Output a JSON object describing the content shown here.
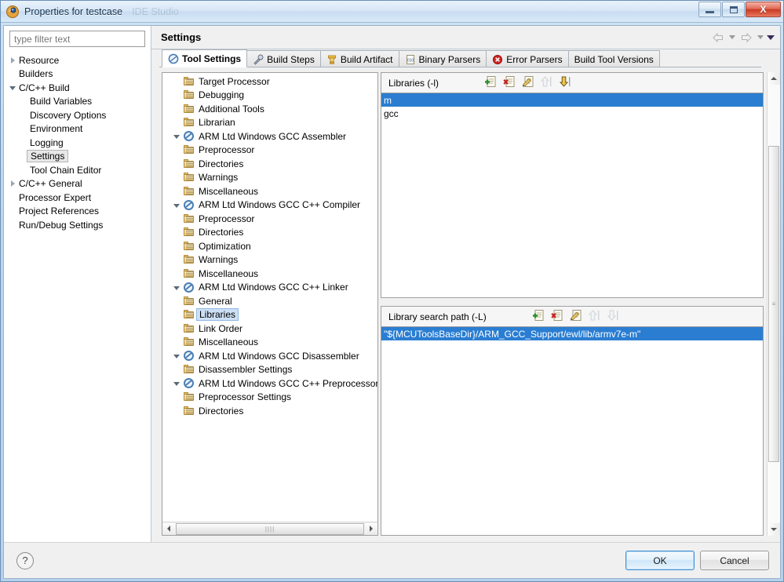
{
  "window": {
    "title": "Properties for testcase",
    "ghost_title": "IDE Studio",
    "app_icon": "eclipse-icon",
    "buttons": {
      "minimize": "minimize-icon",
      "maximize": "maximize-icon",
      "close": "X"
    }
  },
  "filter": {
    "placeholder": "type filter text",
    "value": ""
  },
  "nav_tree": [
    {
      "label": "Resource",
      "indent": 0,
      "twisty": "collapsed",
      "selected": false
    },
    {
      "label": "Builders",
      "indent": 0,
      "twisty": "none",
      "selected": false
    },
    {
      "label": "C/C++ Build",
      "indent": 0,
      "twisty": "expanded",
      "selected": false
    },
    {
      "label": "Build Variables",
      "indent": 1,
      "twisty": "none",
      "selected": false
    },
    {
      "label": "Discovery Options",
      "indent": 1,
      "twisty": "none",
      "selected": false
    },
    {
      "label": "Environment",
      "indent": 1,
      "twisty": "none",
      "selected": false
    },
    {
      "label": "Logging",
      "indent": 1,
      "twisty": "none",
      "selected": false
    },
    {
      "label": "Settings",
      "indent": 1,
      "twisty": "none",
      "selected": true
    },
    {
      "label": "Tool Chain Editor",
      "indent": 1,
      "twisty": "none",
      "selected": false
    },
    {
      "label": "C/C++ General",
      "indent": 0,
      "twisty": "collapsed",
      "selected": false
    },
    {
      "label": "Processor Expert",
      "indent": 0,
      "twisty": "none",
      "selected": false
    },
    {
      "label": "Project References",
      "indent": 0,
      "twisty": "none",
      "selected": false
    },
    {
      "label": "Run/Debug Settings",
      "indent": 0,
      "twisty": "none",
      "selected": false
    }
  ],
  "page": {
    "title": "Settings",
    "nav": {
      "back": "back-arrow-icon",
      "back_menu": "chevron-down-icon",
      "forward": "forward-arrow-icon",
      "forward_menu": "chevron-down-icon",
      "view_menu": "chevron-down-icon"
    }
  },
  "tabs": [
    {
      "label": "Tool Settings",
      "icon": "gear-icon",
      "active": true
    },
    {
      "label": "Build Steps",
      "icon": "wrench-icon",
      "active": false
    },
    {
      "label": "Build Artifact",
      "icon": "artifact-icon",
      "active": false
    },
    {
      "label": "Binary Parsers",
      "icon": "binary-doc-icon",
      "active": false
    },
    {
      "label": "Error Parsers",
      "icon": "error-icon",
      "active": false
    },
    {
      "label": "Build Tool Versions",
      "icon": "none",
      "active": false
    }
  ],
  "tool_tree": [
    {
      "label": "Target Processor",
      "level": 1,
      "twisty": "none",
      "icon": "folder-icon",
      "selected": false
    },
    {
      "label": "Debugging",
      "level": 1,
      "twisty": "none",
      "icon": "folder-icon",
      "selected": false
    },
    {
      "label": "Additional Tools",
      "level": 1,
      "twisty": "none",
      "icon": "folder-icon",
      "selected": false
    },
    {
      "label": "Librarian",
      "level": 1,
      "twisty": "none",
      "icon": "folder-icon",
      "selected": false
    },
    {
      "label": "ARM Ltd Windows GCC Assembler",
      "level": 0,
      "twisty": "expanded",
      "icon": "gear-icon",
      "selected": false
    },
    {
      "label": "Preprocessor",
      "level": 1,
      "twisty": "none",
      "icon": "folder-icon",
      "selected": false
    },
    {
      "label": "Directories",
      "level": 1,
      "twisty": "none",
      "icon": "folder-icon",
      "selected": false
    },
    {
      "label": "Warnings",
      "level": 1,
      "twisty": "none",
      "icon": "folder-icon",
      "selected": false
    },
    {
      "label": "Miscellaneous",
      "level": 1,
      "twisty": "none",
      "icon": "folder-icon",
      "selected": false
    },
    {
      "label": "ARM Ltd Windows GCC C++ Compiler",
      "level": 0,
      "twisty": "expanded",
      "icon": "gear-icon",
      "selected": false
    },
    {
      "label": "Preprocessor",
      "level": 1,
      "twisty": "none",
      "icon": "folder-icon",
      "selected": false
    },
    {
      "label": "Directories",
      "level": 1,
      "twisty": "none",
      "icon": "folder-icon",
      "selected": false
    },
    {
      "label": "Optimization",
      "level": 1,
      "twisty": "none",
      "icon": "folder-icon",
      "selected": false
    },
    {
      "label": "Warnings",
      "level": 1,
      "twisty": "none",
      "icon": "folder-icon",
      "selected": false
    },
    {
      "label": "Miscellaneous",
      "level": 1,
      "twisty": "none",
      "icon": "folder-icon",
      "selected": false
    },
    {
      "label": "ARM Ltd Windows GCC C++ Linker",
      "level": 0,
      "twisty": "expanded",
      "icon": "gear-icon",
      "selected": false
    },
    {
      "label": "General",
      "level": 1,
      "twisty": "none",
      "icon": "folder-icon",
      "selected": false
    },
    {
      "label": "Libraries",
      "level": 1,
      "twisty": "none",
      "icon": "folder-icon",
      "selected": true
    },
    {
      "label": "Link Order",
      "level": 1,
      "twisty": "none",
      "icon": "folder-icon",
      "selected": false
    },
    {
      "label": "Miscellaneous",
      "level": 1,
      "twisty": "none",
      "icon": "folder-icon",
      "selected": false
    },
    {
      "label": "ARM Ltd Windows GCC Disassembler",
      "level": 0,
      "twisty": "expanded",
      "icon": "gear-icon",
      "selected": false
    },
    {
      "label": "Disassembler Settings",
      "level": 1,
      "twisty": "none",
      "icon": "folder-icon",
      "selected": false
    },
    {
      "label": "ARM Ltd Windows GCC C++ Preprocessor",
      "level": 0,
      "twisty": "expanded",
      "icon": "gear-icon",
      "selected": false
    },
    {
      "label": "Preprocessor Settings",
      "level": 1,
      "twisty": "none",
      "icon": "folder-icon",
      "selected": false
    },
    {
      "label": "Directories",
      "level": 1,
      "twisty": "none",
      "icon": "folder-icon",
      "selected": false
    }
  ],
  "libraries_panel": {
    "title": "Libraries (-l)",
    "toolbar": [
      {
        "name": "add-icon",
        "enabled": true
      },
      {
        "name": "delete-icon",
        "enabled": true
      },
      {
        "name": "edit-icon",
        "enabled": true
      },
      {
        "name": "move-up-icon",
        "enabled": false
      },
      {
        "name": "move-down-icon",
        "enabled": true
      }
    ],
    "items": [
      {
        "value": "m",
        "selected": true
      },
      {
        "value": "gcc",
        "selected": false
      }
    ]
  },
  "search_path_panel": {
    "title": "Library search path (-L)",
    "toolbar": [
      {
        "name": "add-icon",
        "enabled": true
      },
      {
        "name": "delete-icon",
        "enabled": true
      },
      {
        "name": "edit-icon",
        "enabled": true
      },
      {
        "name": "move-up-icon",
        "enabled": false
      },
      {
        "name": "move-down-icon",
        "enabled": false
      }
    ],
    "items": [
      {
        "value": "\"${MCUToolsBaseDir}/ARM_GCC_Support/ewl/lib/armv7e-m\"",
        "selected": true
      }
    ]
  },
  "scrollbars": {
    "h_thumb_glyph": "||||",
    "v_thumb_glyph": "≡"
  },
  "footer": {
    "help": "?",
    "ok": "OK",
    "cancel": "Cancel"
  },
  "colors": {
    "selection_blue": "#2a7dd1",
    "tree_selection": "#cde0f5",
    "title_bar": "#d6e6f6",
    "close_red": "#c93a22",
    "dialog_bg": "#f0f0f0"
  }
}
